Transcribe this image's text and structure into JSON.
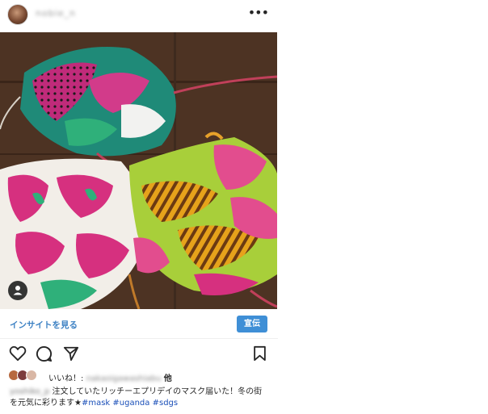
{
  "post": {
    "header": {
      "username": "nobie_n",
      "more_label": "•••"
    },
    "insight_link": "インサイトを見る",
    "promote_label": "宣伝",
    "likes": {
      "prefix": "いいね！:",
      "liker": "nakaoigawashiabu",
      "suffix": "他"
    },
    "caption": {
      "username": "yoshiko_p",
      "text_line1": " 注文していたリッチーエプリデイのマスク届いた！冬の街",
      "text_line2": "を元気に彩ります★",
      "tag1": "#mask",
      "tag2": "#uganda",
      "tag3": "#sdgs"
    }
  }
}
